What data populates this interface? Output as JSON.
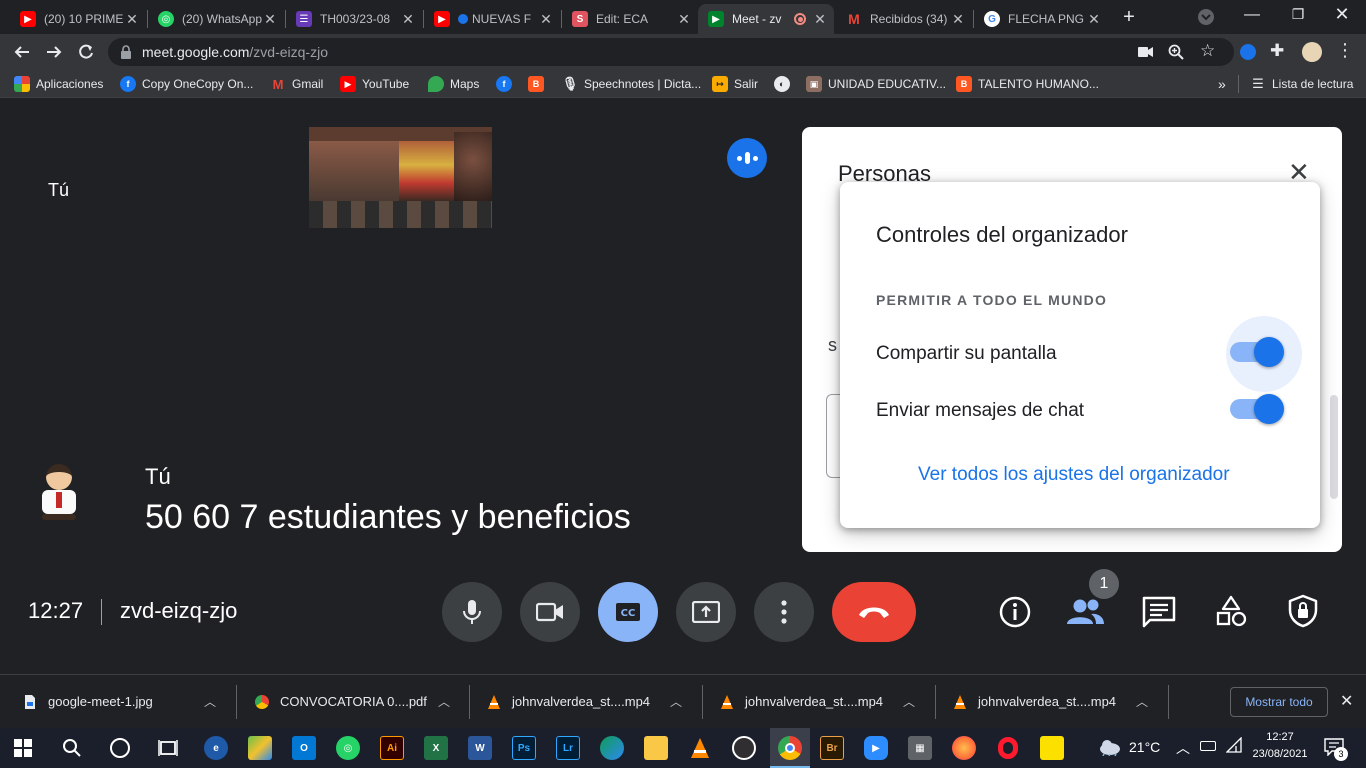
{
  "browser": {
    "tabs": [
      {
        "title": "(20) 10 PRIME",
        "icon": "youtube-icon",
        "color": "#ff0000"
      },
      {
        "title": "(20) WhatsApp",
        "icon": "whatsapp-icon",
        "color": "#25d366"
      },
      {
        "title": "TH003/23-08",
        "icon": "forms-icon",
        "color": "#673ab7"
      },
      {
        "title": "NUEVAS F",
        "icon": "youtube-icon",
        "color": "#ff0000"
      },
      {
        "title": "Edit: ECA",
        "icon": "s-icon",
        "color": "#e0545f"
      },
      {
        "title": "Meet - zv",
        "icon": "meet-icon",
        "color": "#00832d"
      },
      {
        "title": "Recibidos (34)",
        "icon": "gmail-icon",
        "color": "#ea4335"
      },
      {
        "title": "FLECHA PNG",
        "icon": "google-icon",
        "color": "#4285f4"
      }
    ],
    "new_tab": "+",
    "url_domain": "meet.google.com",
    "url_path": "/zvd-eizq-zjo",
    "bookmarks": [
      {
        "label": "Aplicaciones",
        "icon": "apps-grid-icon",
        "color": "#ea4335"
      },
      {
        "label": "Copy OneCopy On...",
        "icon": "facebook-icon",
        "color": "#1877f2"
      },
      {
        "label": "Gmail",
        "icon": "gmail-icon",
        "color": "#ea4335"
      },
      {
        "label": "YouTube",
        "icon": "youtube-icon",
        "color": "#ff0000"
      },
      {
        "label": "Maps",
        "icon": "maps-icon",
        "color": "#34a853"
      },
      {
        "label": "",
        "icon": "facebook-icon",
        "color": "#1877f2"
      },
      {
        "label": "",
        "icon": "blogger-icon",
        "color": "#ff5722"
      },
      {
        "label": "Speechnotes | Dicta...",
        "icon": "microphone-icon",
        "color": "#202124"
      },
      {
        "label": "Salir",
        "icon": "exit-icon",
        "color": "#f9ab00"
      },
      {
        "label": "",
        "icon": "globe-icon",
        "color": "#5f6368"
      },
      {
        "label": "UNIDAD EDUCATIV...",
        "icon": "school-icon",
        "color": "#8d6e63"
      },
      {
        "label": "TALENTO HUMANO...",
        "icon": "blogger-icon",
        "color": "#ff5722"
      }
    ],
    "reading_list": "Lista de lectura",
    "more_bookmarks": "»"
  },
  "meet": {
    "self_label": "Tú",
    "caption_speaker": "Tú",
    "caption_text": "50 60 7 estudiantes y beneficios",
    "time": "12:27",
    "meeting_code": "zvd-eizq-zjo",
    "participants_count": "1",
    "panel": {
      "title": "Personas",
      "partial_letter": "s",
      "close": "✕"
    },
    "host_controls": {
      "title": "Controles del organizador",
      "section": "PERMITIR A TODO EL MUNDO",
      "share_screen": {
        "label": "Compartir su pantalla",
        "on": true
      },
      "chat": {
        "label": "Enviar mensajes de chat",
        "on": true
      },
      "all_settings": "Ver todos los ajustes del organizador"
    },
    "colors": {
      "accent": "#1a73e8",
      "end_call": "#ea4335",
      "captions_on": "#8ab4f8"
    }
  },
  "downloads": {
    "items": [
      {
        "name": "google-meet-1.jpg",
        "icon": "image-file-icon"
      },
      {
        "name": "CONVOCATORIA 0....pdf",
        "icon": "chrome-pdf-icon"
      },
      {
        "name": "johnvalverdea_st....mp4",
        "icon": "vlc-icon"
      },
      {
        "name": "johnvalverdea_st....mp4",
        "icon": "vlc-icon"
      },
      {
        "name": "johnvalverdea_st....mp4",
        "icon": "vlc-icon"
      }
    ],
    "show_all": "Mostrar todo"
  },
  "taskbar": {
    "weather": "21°C",
    "time": "12:27",
    "date": "23/08/2021",
    "notifications": "3",
    "apps": [
      {
        "name": "edge-legacy-icon",
        "label": "",
        "color": "#1e5aa8"
      },
      {
        "name": "bluestacks-icon",
        "label": "",
        "color": "#6abf4b"
      },
      {
        "name": "outlook-icon",
        "label": "O",
        "color": "#0078d4"
      },
      {
        "name": "whatsapp-icon",
        "label": "",
        "color": "#25d366"
      },
      {
        "name": "illustrator-icon",
        "label": "Ai",
        "color": "#330000"
      },
      {
        "name": "excel-icon",
        "label": "X",
        "color": "#217346"
      },
      {
        "name": "word-icon",
        "label": "W",
        "color": "#2b579a"
      },
      {
        "name": "photoshop-icon",
        "label": "Ps",
        "color": "#001e36"
      },
      {
        "name": "lightroom-icon",
        "label": "Lr",
        "color": "#001e36"
      },
      {
        "name": "edge-icon",
        "label": "",
        "color": "#0f9d58"
      },
      {
        "name": "file-explorer-icon",
        "label": "",
        "color": "#f9c846"
      },
      {
        "name": "vlc-icon",
        "label": "",
        "color": "#ff8800"
      },
      {
        "name": "obs-icon",
        "label": "",
        "color": "#302e31"
      },
      {
        "name": "chrome-icon",
        "label": "",
        "color": "#4285f4"
      },
      {
        "name": "bridge-icon",
        "label": "Br",
        "color": "#2a1a00"
      },
      {
        "name": "zoom-icon",
        "label": "",
        "color": "#2d8cff"
      },
      {
        "name": "calculator-icon",
        "label": "",
        "color": "#5f6368"
      },
      {
        "name": "firefox-icon",
        "label": "",
        "color": "#ff7139"
      },
      {
        "name": "opera-icon",
        "label": "",
        "color": "#ff1b2d"
      },
      {
        "name": "sticky-notes-icon",
        "label": "",
        "color": "#fce100"
      }
    ]
  }
}
